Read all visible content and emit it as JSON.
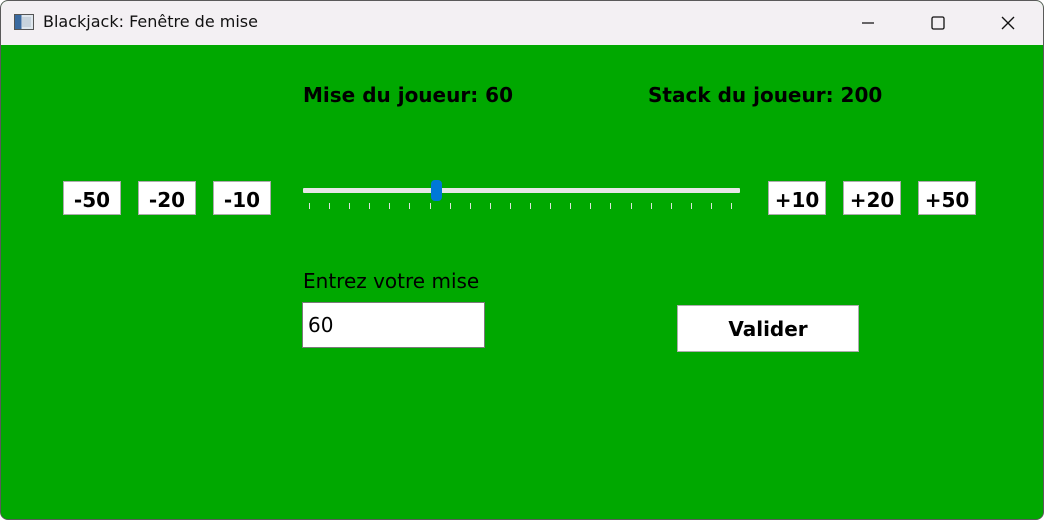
{
  "window": {
    "title": "Blackjack: Fenêtre de mise",
    "controls": [
      "minimize",
      "maximize",
      "close"
    ]
  },
  "info": {
    "bet_label": "Mise du joueur: 60",
    "stack_label": "Stack du joueur: 200"
  },
  "decrease_buttons": [
    "-50",
    "-20",
    "-10"
  ],
  "increase_buttons": [
    "+10",
    "+20",
    "+50"
  ],
  "slider": {
    "value": 60,
    "max": 200,
    "fraction": 0.3,
    "tick_count": 22
  },
  "bet_entry": {
    "label": "Entrez votre mise",
    "value": "60"
  },
  "validate_label": "Valider",
  "colors": {
    "background": "#00a800",
    "slider_thumb": "#0078d7",
    "titlebar": "#f3f0f3"
  },
  "icons": {
    "app": "app-window-icon",
    "minimize": "minimize-icon",
    "maximize": "maximize-icon",
    "close": "close-icon"
  }
}
